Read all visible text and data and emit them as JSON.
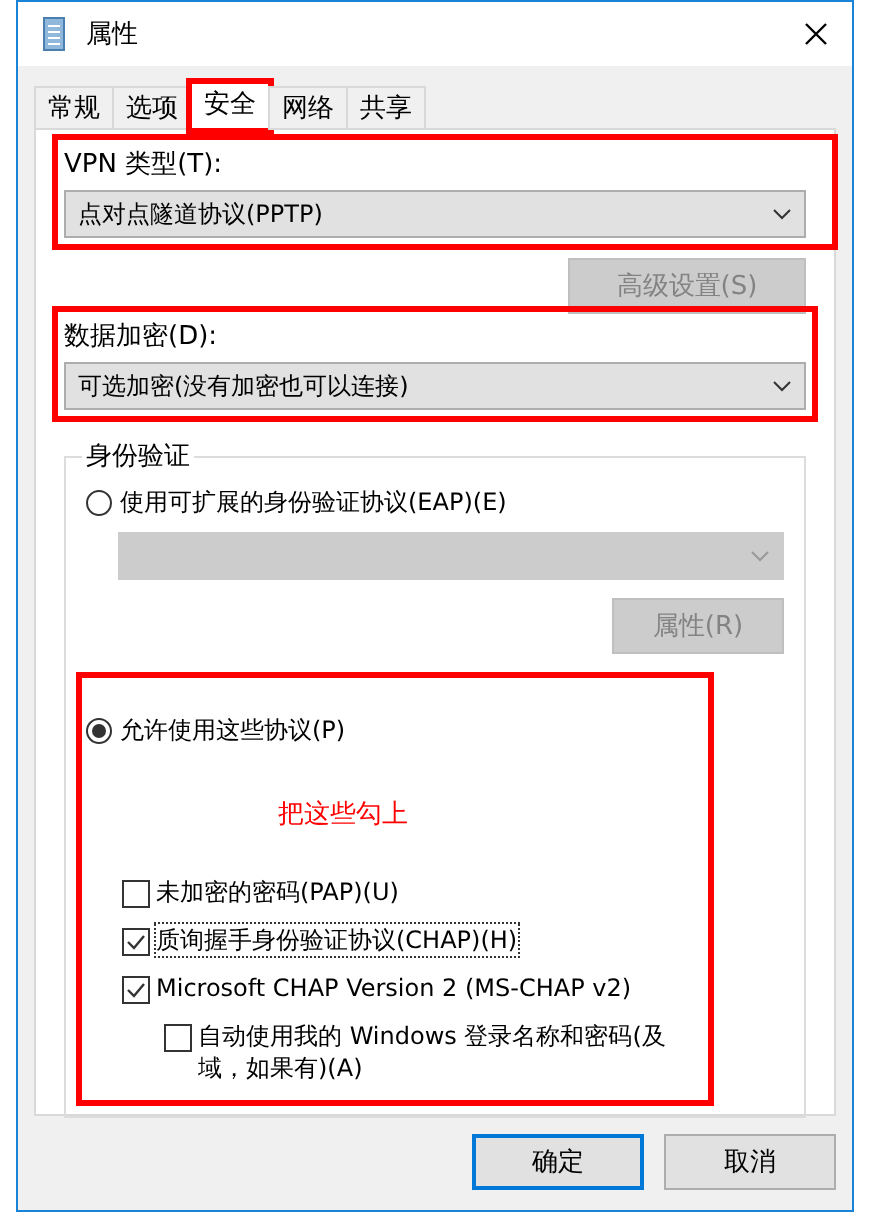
{
  "window": {
    "title": "属性"
  },
  "tabs": [
    {
      "label": "常规",
      "selected": false,
      "highlighted": false
    },
    {
      "label": "选项",
      "selected": false,
      "highlighted": false
    },
    {
      "label": "安全",
      "selected": true,
      "highlighted": true
    },
    {
      "label": "网络",
      "selected": false,
      "highlighted": false
    },
    {
      "label": "共享",
      "selected": false,
      "highlighted": false
    }
  ],
  "vpn_type": {
    "label": "VPN 类型(T):",
    "value": "点对点隧道协议(PPTP)",
    "highlighted": true
  },
  "advanced_button": {
    "label": "高级设置(S)",
    "disabled": true
  },
  "encryption": {
    "label": "数据加密(D):",
    "value": "可选加密(没有加密也可以连接)",
    "highlighted": true
  },
  "authentication": {
    "title": "身份验证",
    "eap_option": {
      "label": "使用可扩展的身份验证协议(EAP)(E)",
      "selected": false
    },
    "eap_properties_button": {
      "label": "属性(R)",
      "disabled": true
    },
    "protocols_option": {
      "label": "允许使用这些协议(P)",
      "selected": true,
      "highlighted": true
    },
    "note": "把这些勾上",
    "protocols": [
      {
        "label": "未加密的密码(PAP)(U)",
        "checked": false,
        "focused": false
      },
      {
        "label": "质询握手身份验证协议(CHAP)(H)",
        "checked": true,
        "focused": true
      },
      {
        "label": "Microsoft CHAP Version 2 (MS-CHAP v2)",
        "checked": true,
        "focused": false,
        "children": [
          {
            "label": "自动使用我的 Windows 登录名称和密码(及域，如果有)(A)",
            "checked": false,
            "focused": false
          }
        ]
      }
    ]
  },
  "buttons": [
    {
      "label": "确定",
      "default": true
    },
    {
      "label": "取消",
      "default": false
    }
  ]
}
